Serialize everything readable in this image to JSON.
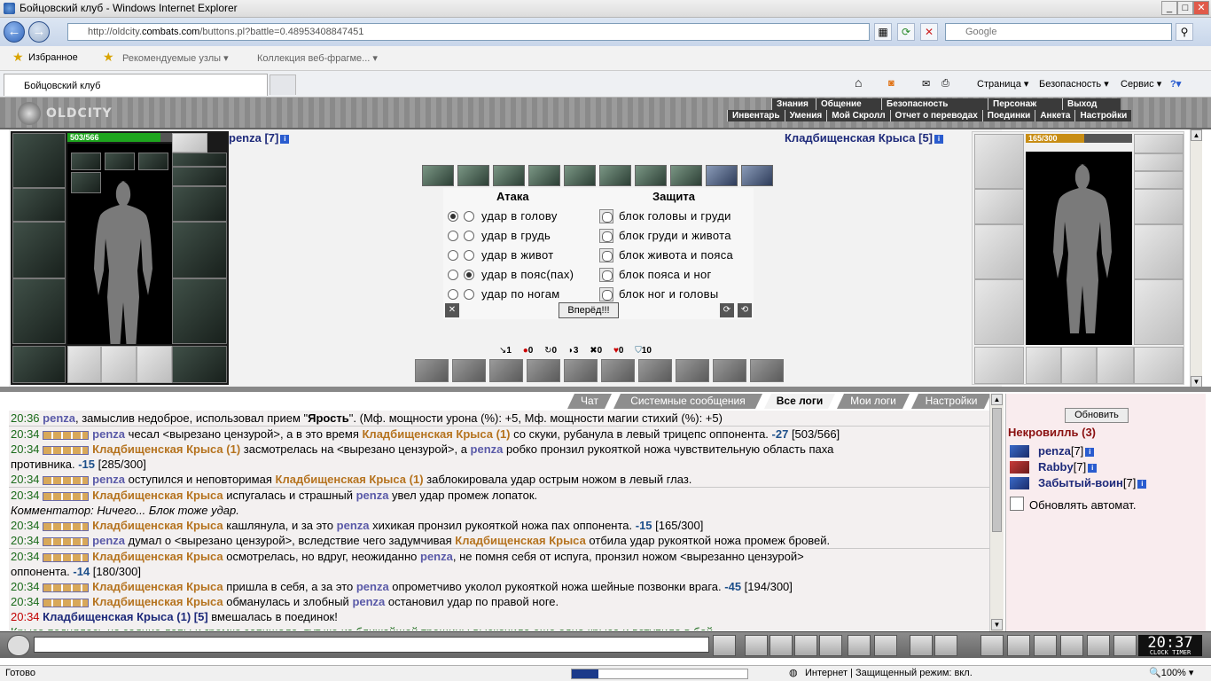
{
  "window": {
    "title": "Бойцовский клуб - Windows Internet Explorer"
  },
  "address": {
    "prefix": "http://oldcity.",
    "host": "combats.com",
    "path": "/buttons.pl?battle=0.48953408847451",
    "search_placeholder": "Google"
  },
  "favorites": {
    "fav_label": "Избранное",
    "item1": "Рекомендуемые узлы ▾",
    "item2": "Коллекция веб-фрагме... ▾"
  },
  "tabs": {
    "active": "Бойцовский клуб"
  },
  "commands": {
    "page": "Страница ▾",
    "safety": "Безопасность ▾",
    "service": "Сервис ▾"
  },
  "game": {
    "logo": "OLDCITY",
    "menu_top": [
      "Знания",
      "Общение",
      "Безопасность",
      "Персонаж",
      "Выход"
    ],
    "menu_sub": [
      "Инвентарь",
      "Умения",
      "Мой Скролл",
      "Отчет о переводах",
      "Поединки",
      "Анкета",
      "Настройки"
    ],
    "player": {
      "name": "penza [7]",
      "hp": "503/566",
      "hp_fraction": 0.89
    },
    "enemy": {
      "name": "Кладбищенская Крыса [5]",
      "hp": "165/300",
      "hp_fraction": 0.55
    },
    "panel": {
      "attack_header": "Атака",
      "defense_header": "Защита",
      "attacks": [
        "удар в голову",
        "удар в грудь",
        "удар в живот",
        "удар в пояс(пах)",
        "удар по ногам"
      ],
      "blocks": [
        "блок головы и груди",
        "блок груди и живота",
        "блок живота и пояса",
        "блок пояса и ног",
        "блок ног и головы"
      ],
      "forward": "Вперёд!!!"
    },
    "stats": [
      "1",
      "0",
      "0",
      "3",
      "0",
      "0",
      "10"
    ]
  },
  "logtabs": [
    "Чат",
    "Системные сообщения",
    "Все логи",
    "Мои логи",
    "Настройки"
  ],
  "log": [
    {
      "t": "20:36",
      "parts": [
        [
          "p1",
          "penza"
        ],
        [
          "",
          ", замыслив недоброе, использовал прием \""
        ],
        [
          "b",
          "Ярость"
        ],
        [
          "",
          "\". (Мф. мощности урона (%): +5, Мф. мощности магии стихий (%): +5)"
        ]
      ]
    },
    {
      "t": "20:34",
      "sep": true,
      "sq": true,
      "parts": [
        [
          "p1",
          "penza"
        ],
        [
          "",
          " чесал <вырезано цензурой>, а в это время "
        ],
        [
          "p2",
          "Кладбищенская Крыса (1)"
        ],
        [
          "",
          " со скуки, рубанула в левый трицепс оппонента. "
        ],
        [
          "num",
          "-27"
        ],
        [
          "",
          " [503/566]"
        ]
      ]
    },
    {
      "t": "20:34",
      "sq": true,
      "parts": [
        [
          "p2",
          "Кладбищенская Крыса (1)"
        ],
        [
          "",
          " засмотрелась на <вырезано цензурой>, а "
        ],
        [
          "p1",
          "penza"
        ],
        [
          "",
          " робко пронзил рукояткой ножа чувствительную область паха"
        ]
      ]
    },
    {
      "t": "",
      "parts": [
        [
          "",
          "противника. "
        ],
        [
          "num",
          "-15"
        ],
        [
          "",
          " [285/300]"
        ]
      ]
    },
    {
      "t": "20:34",
      "sq": true,
      "parts": [
        [
          "p1",
          "penza"
        ],
        [
          "",
          " оступился и неповторимая "
        ],
        [
          "p2",
          "Кладбищенская Крыса (1)"
        ],
        [
          "",
          " заблокировала удар острым ножом в левый глаз."
        ]
      ]
    },
    {
      "t": "20:34",
      "sep": true,
      "sq": true,
      "parts": [
        [
          "p2",
          "Кладбищенская Крыса"
        ],
        [
          "",
          " испугалась и страшный "
        ],
        [
          "p1",
          "penza"
        ],
        [
          "",
          " увел удар промеж лопаток."
        ]
      ]
    },
    {
      "t": "",
      "com": true,
      "parts": [
        [
          "com",
          "Комментатор: Ничего... Блок тоже удар."
        ]
      ]
    },
    {
      "t": "20:34",
      "sq": true,
      "parts": [
        [
          "p2",
          "Кладбищенская Крыса"
        ],
        [
          "",
          " кашлянула, и за это "
        ],
        [
          "p1",
          "penza"
        ],
        [
          "",
          " хихикая пронзил рукояткой ножа пах оппонента. "
        ],
        [
          "num",
          "-15"
        ],
        [
          "",
          " [165/300]"
        ]
      ]
    },
    {
      "t": "20:34",
      "sq": true,
      "parts": [
        [
          "p1",
          "penza"
        ],
        [
          "",
          " думал о <вырезано цензурой>, вследствие чего задумчивая "
        ],
        [
          "p2",
          "Кладбищенская Крыса"
        ],
        [
          "",
          " отбила удар рукояткой ножа промеж бровей."
        ]
      ]
    },
    {
      "t": "20:34",
      "sep": true,
      "sq": true,
      "parts": [
        [
          "p2",
          "Кладбищенская Крыса"
        ],
        [
          "",
          " осмотрелась, но вдруг, неожиданно "
        ],
        [
          "p1",
          "penza"
        ],
        [
          "",
          ", не помня себя от испуга, пронзил ножом <вырезанно цензурой>"
        ]
      ]
    },
    {
      "t": "",
      "parts": [
        [
          "",
          "оппонента. "
        ],
        [
          "num",
          "-14"
        ],
        [
          "",
          " [180/300]"
        ]
      ]
    },
    {
      "t": "20:34",
      "sq": true,
      "parts": [
        [
          "p2",
          "Кладбищенская Крыса"
        ],
        [
          "",
          " пришла в себя, а за это "
        ],
        [
          "p1",
          "penza"
        ],
        [
          "",
          " опрометчиво уколол рукояткой ножа шейные позвонки врага. "
        ],
        [
          "num",
          "-45"
        ],
        [
          "",
          " [194/300]"
        ]
      ]
    },
    {
      "t": "20:34",
      "sq": true,
      "parts": [
        [
          "p2",
          "Кладбищенская Крыса"
        ],
        [
          "",
          " обманулась и злобный "
        ],
        [
          "p1",
          "penza"
        ],
        [
          "",
          " остановил удар по правой ноге."
        ]
      ]
    },
    {
      "t": "20:34",
      "red": true,
      "parts": [
        [
          "b2",
          "Кладбищенская Крыса (1) [5]"
        ],
        [
          "",
          " вмешалась в поединок!"
        ]
      ]
    },
    {
      "t": "",
      "parts": [
        [
          "g",
          "Крыса поднялась на задние лапы и громко запищала, тут же из ближайшей трещины выскочила еще одна крыса и вступила в бой."
        ]
      ]
    }
  ],
  "side": {
    "refresh": "Обновить",
    "group": "Некровилль (3)",
    "members": [
      {
        "name": "penza",
        "lv": "[7]"
      },
      {
        "name": "Rabby",
        "lv": "[7]"
      },
      {
        "name": "Забытый-воин",
        "lv": "[7]"
      }
    ],
    "auto": "Обновлять автомат."
  },
  "clock": {
    "time": "20:37",
    "sub": "CLOCK TIMER"
  },
  "statusbar": {
    "left": "Готово",
    "zone": "Интернет | Защищенный режим: вкл.",
    "zoom": "100%"
  }
}
